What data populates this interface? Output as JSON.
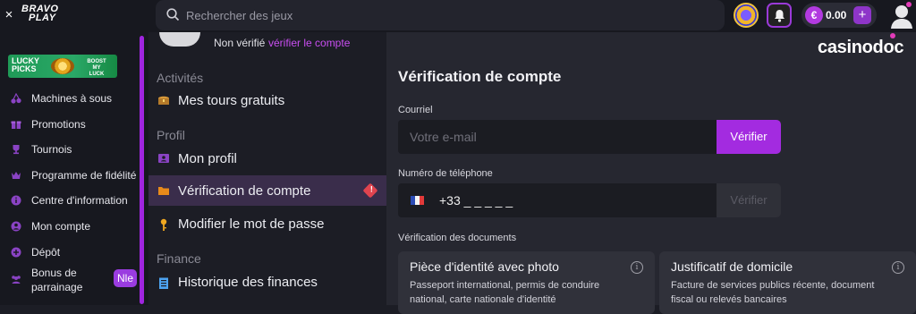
{
  "topbar": {
    "close_glyph": "×",
    "logo_line1": "BRAVO",
    "logo_line2": "PLAY",
    "search_placeholder": "Rechercher des jeux",
    "search_icon": "search-icon",
    "balance": "0.00",
    "currency_glyph": "€",
    "add_glyph": "+"
  },
  "sidebar": {
    "banner": {
      "line1": "LUCKY",
      "line2": "PICKS",
      "tag1": "BOOST",
      "tag2": "MY LUCK"
    },
    "items": [
      {
        "label": "Machines à sous",
        "icon": "cherries-icon"
      },
      {
        "label": "Promotions",
        "icon": "gift-icon"
      },
      {
        "label": "Tournois",
        "icon": "trophy-icon"
      },
      {
        "label": "Programme de fidélité",
        "icon": "crown-icon"
      },
      {
        "label": "Centre d'information",
        "icon": "info-icon"
      },
      {
        "label": "Mon compte",
        "icon": "account-icon"
      },
      {
        "label": "Dépôt",
        "icon": "deposit-icon"
      },
      {
        "label": "Bonus de parrainage",
        "icon": "referral-icon",
        "badge": "Nle"
      }
    ]
  },
  "menu": {
    "unverified": "Non vérifié",
    "verify_link": "vérifier le compte",
    "sections": {
      "activities": "Activités",
      "profile": "Profil",
      "finance": "Finance"
    },
    "items": {
      "free_spins": "Mes tours gratuits",
      "my_profile": "Mon profil",
      "account_verification": "Vérification de compte",
      "change_password": "Modifier le mot de passe",
      "finance_history": "Historique des finances"
    },
    "alert_glyph": "!"
  },
  "main": {
    "watermark": "casinodoc",
    "title": "Vérification de compte",
    "email": {
      "label": "Courriel",
      "placeholder": "Votre e-mail",
      "button": "Vérifier"
    },
    "phone": {
      "label": "Numéro de téléphone",
      "value": "+33 _ _ _ _ _",
      "button": "Vérifier"
    },
    "documents": {
      "label": "Vérification des documents",
      "cards": [
        {
          "title": "Pièce d'identité avec photo",
          "desc": "Passeport international, permis de conduire national, carte nationale d'identité"
        },
        {
          "title": "Justificatif de domicile",
          "desc": "Facture de services publics récente, document fiscal ou relevés bancaires"
        }
      ]
    }
  },
  "colors": {
    "accent": "#a32be0",
    "sidebar_bg": "#17181f",
    "main_bg": "#262730",
    "alert": "#e0444f",
    "active_row": "#3a2d4b"
  }
}
